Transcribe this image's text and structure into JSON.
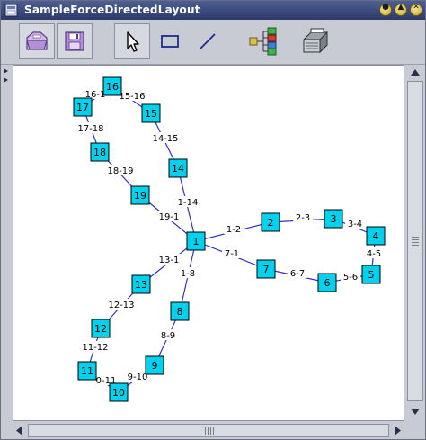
{
  "window": {
    "title": "SampleForceDirectedLayout"
  },
  "toolbar": {
    "buttons": [
      {
        "id": "open",
        "icon": "open-folder-icon"
      },
      {
        "id": "save",
        "icon": "floppy-save-icon"
      },
      {
        "id": "select",
        "icon": "select-arrow-icon"
      },
      {
        "id": "rectangle",
        "icon": "rectangle-tool-icon"
      },
      {
        "id": "line",
        "icon": "line-tool-icon"
      },
      {
        "id": "layout",
        "icon": "tree-layout-icon"
      },
      {
        "id": "print",
        "icon": "printer-icon"
      }
    ]
  },
  "colors": {
    "node_fill": "#00d2ee",
    "edge": "#3232c8",
    "titlebar": "#354478"
  },
  "graph": {
    "nodes": [
      {
        "id": "1"
      },
      {
        "id": "2"
      },
      {
        "id": "3"
      },
      {
        "id": "4"
      },
      {
        "id": "5"
      },
      {
        "id": "6"
      },
      {
        "id": "7"
      },
      {
        "id": "8"
      },
      {
        "id": "9"
      },
      {
        "id": "10"
      },
      {
        "id": "11"
      },
      {
        "id": "12"
      },
      {
        "id": "13"
      },
      {
        "id": "14"
      },
      {
        "id": "15"
      },
      {
        "id": "16"
      },
      {
        "id": "17"
      },
      {
        "id": "18"
      },
      {
        "id": "19"
      }
    ],
    "edges": [
      {
        "id": "1-2",
        "from": "1",
        "to": "2"
      },
      {
        "id": "2-3",
        "from": "2",
        "to": "3"
      },
      {
        "id": "3-4",
        "from": "3",
        "to": "4"
      },
      {
        "id": "4-5",
        "from": "4",
        "to": "5"
      },
      {
        "id": "5-6",
        "from": "5",
        "to": "6"
      },
      {
        "id": "6-7",
        "from": "6",
        "to": "7"
      },
      {
        "id": "7-1",
        "from": "7",
        "to": "1"
      },
      {
        "id": "1-8",
        "from": "1",
        "to": "8"
      },
      {
        "id": "8-9",
        "from": "8",
        "to": "9"
      },
      {
        "id": "9-10",
        "from": "9",
        "to": "10"
      },
      {
        "id": "0-11",
        "from": "10",
        "to": "11"
      },
      {
        "id": "11-12",
        "from": "11",
        "to": "12"
      },
      {
        "id": "12-13",
        "from": "12",
        "to": "13"
      },
      {
        "id": "13-1",
        "from": "13",
        "to": "1"
      },
      {
        "id": "1-14",
        "from": "1",
        "to": "14"
      },
      {
        "id": "14-15",
        "from": "14",
        "to": "15"
      },
      {
        "id": "15-16",
        "from": "15",
        "to": "16"
      },
      {
        "id": "16-1",
        "from": "16",
        "to": "17"
      },
      {
        "id": "17-18",
        "from": "17",
        "to": "18"
      },
      {
        "id": "18-19",
        "from": "18",
        "to": "19"
      },
      {
        "id": "19-1",
        "from": "19",
        "to": "1"
      }
    ]
  }
}
